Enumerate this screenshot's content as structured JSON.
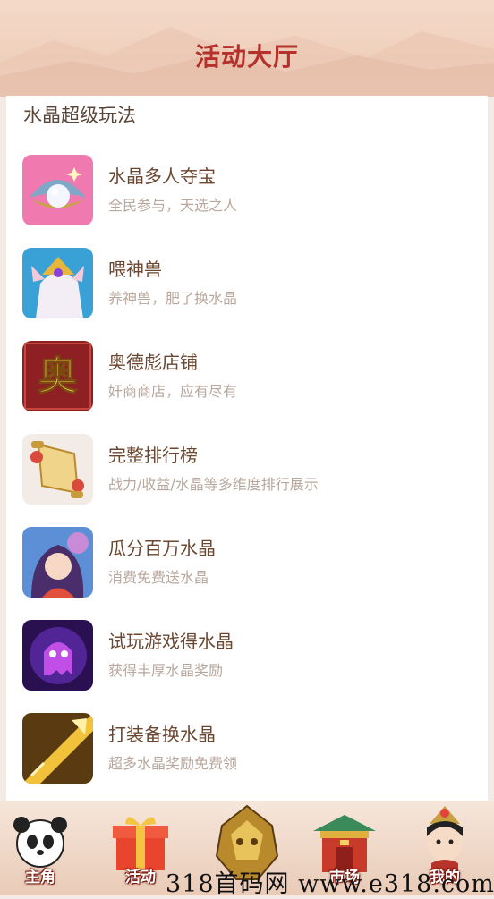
{
  "header": {
    "title": "活动大厅"
  },
  "section": {
    "title": "水晶超级玩法"
  },
  "items": [
    {
      "title": "水晶多人夺宝",
      "subtitle": "全民参与，天选之人",
      "icon": "pearl-shell-icon"
    },
    {
      "title": "喂神兽",
      "subtitle": "养神兽，肥了换水晶",
      "icon": "divine-beast-icon"
    },
    {
      "title": "奥德彪店铺",
      "subtitle": "奸商商店，应有尽有",
      "icon": "ao-shop-icon",
      "icon_text": "奥"
    },
    {
      "title": "完整排行榜",
      "subtitle": "战力/收益/水晶等多维度排行展示",
      "icon": "scroll-icon"
    },
    {
      "title": "瓜分百万水晶",
      "subtitle": "消费免费送水晶",
      "icon": "fairy-girl-icon"
    },
    {
      "title": "试玩游戏得水晶",
      "subtitle": "获得丰厚水晶奖励",
      "icon": "purple-ghost-icon"
    },
    {
      "title": "打装备换水晶",
      "subtitle": "超多水晶奖励免费领",
      "icon": "golden-spear-icon"
    }
  ],
  "tabbar": {
    "tabs": [
      {
        "label": "主角",
        "icon": "panda-icon"
      },
      {
        "label": "活动",
        "icon": "gift-box-icon"
      },
      {
        "label": "",
        "icon": "dragon-helmet-icon"
      },
      {
        "label": "市场",
        "icon": "pavilion-icon"
      },
      {
        "label": "我的",
        "icon": "avatar-icon"
      }
    ]
  },
  "watermark": {
    "text": "318首码网 www.e318.com"
  },
  "colors": {
    "title_red": "#b5322c",
    "item_title": "#6b4630",
    "item_sub": "#b8a79c"
  }
}
